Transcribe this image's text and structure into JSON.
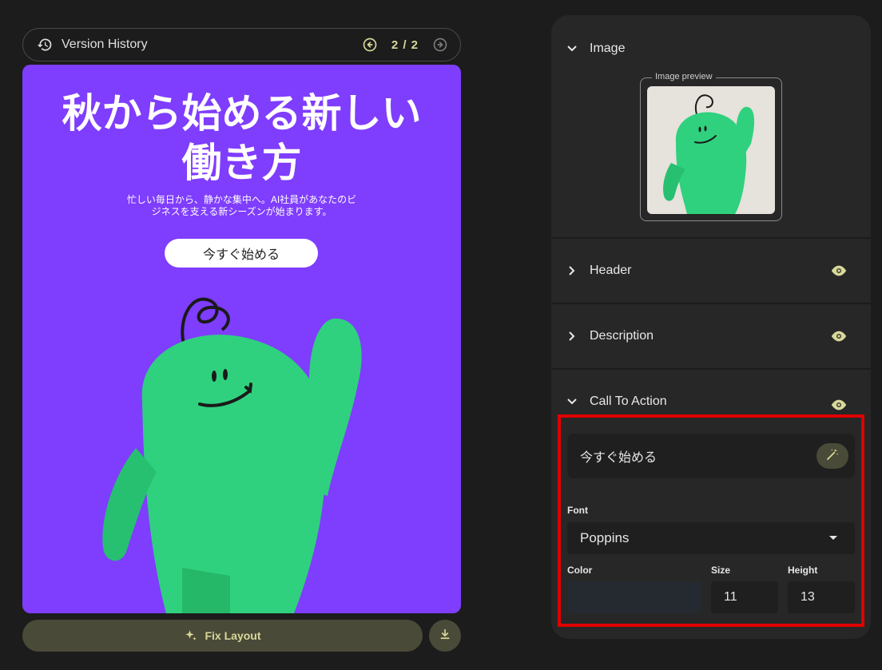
{
  "version_bar": {
    "title": "Version History",
    "counter": "2 / 2",
    "icons": {
      "history": "history-icon",
      "prev": "arrow-left-circle-icon",
      "next": "arrow-right-circle-icon"
    }
  },
  "card": {
    "headline": "秋から始める新しい働き方",
    "subtext": "忙しい毎日から、静かな集中へ。AI社員があなたのビジネスを支える新シーズンが始まります。",
    "cta_label": "今すぐ始める",
    "background_color": "#7f3dfe"
  },
  "actions": {
    "fix_layout_label": "Fix Layout",
    "icons": {
      "sparkle": "sparkle-icon",
      "download": "download-icon"
    }
  },
  "panel": {
    "image_section": {
      "label": "Image",
      "preview_legend": "Image preview"
    },
    "header_section": {
      "label": "Header"
    },
    "description_section": {
      "label": "Description"
    },
    "cta_section": {
      "label": "Call To Action",
      "text_value": "今すぐ始める",
      "font_label": "Font",
      "font_value": "Poppins",
      "color_label": "Color",
      "size_label": "Size",
      "size_value": "11",
      "height_label": "Height",
      "height_value": "13"
    }
  },
  "colors": {
    "accent": "#d8d89a",
    "eye_icon": "#d8d89a",
    "highlight_border": "#e00000",
    "mascot_green": "#2fd17e"
  }
}
